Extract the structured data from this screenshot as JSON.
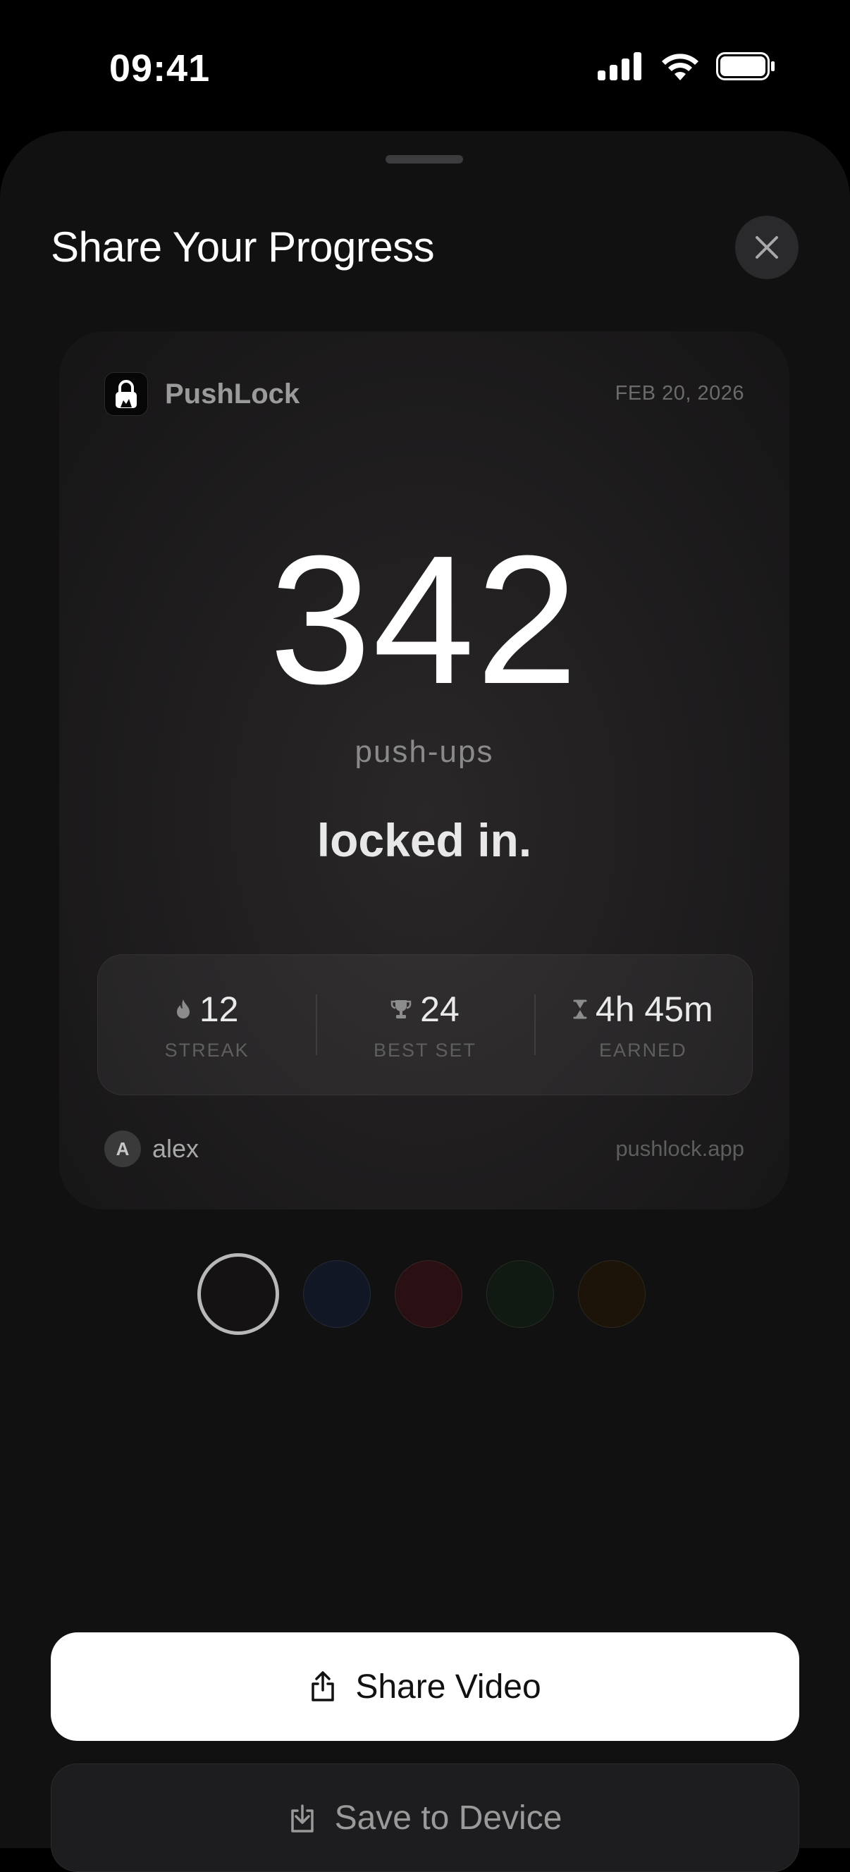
{
  "status_bar": {
    "time": "09:41",
    "icons": [
      "signal-icon",
      "wifi-icon",
      "battery-icon"
    ]
  },
  "sheet": {
    "title": "Share Your Progress",
    "close_icon": "close-icon"
  },
  "card": {
    "brand_name": "PushLock",
    "brand_icon": "lock-icon",
    "date": "FEB 20, 2026",
    "count": "342",
    "count_unit": "push-ups",
    "tagline": "locked in.",
    "stats": [
      {
        "icon": "flame-icon",
        "value": "12",
        "label": "STREAK"
      },
      {
        "icon": "trophy-icon",
        "value": "24",
        "label": "BEST SET"
      },
      {
        "icon": "hourglass-icon",
        "value": "4h 45m",
        "label": "EARNED"
      }
    ],
    "user_initial": "A",
    "username": "alex",
    "url": "pushlock.app"
  },
  "themes": {
    "selected_index": 0,
    "colors": [
      "#141213",
      "#121726",
      "#2a1012",
      "#101a12",
      "#1c1409"
    ]
  },
  "actions": {
    "share_label": "Share Video",
    "share_icon": "share-icon",
    "save_label": "Save to Device",
    "save_icon": "download-icon"
  }
}
